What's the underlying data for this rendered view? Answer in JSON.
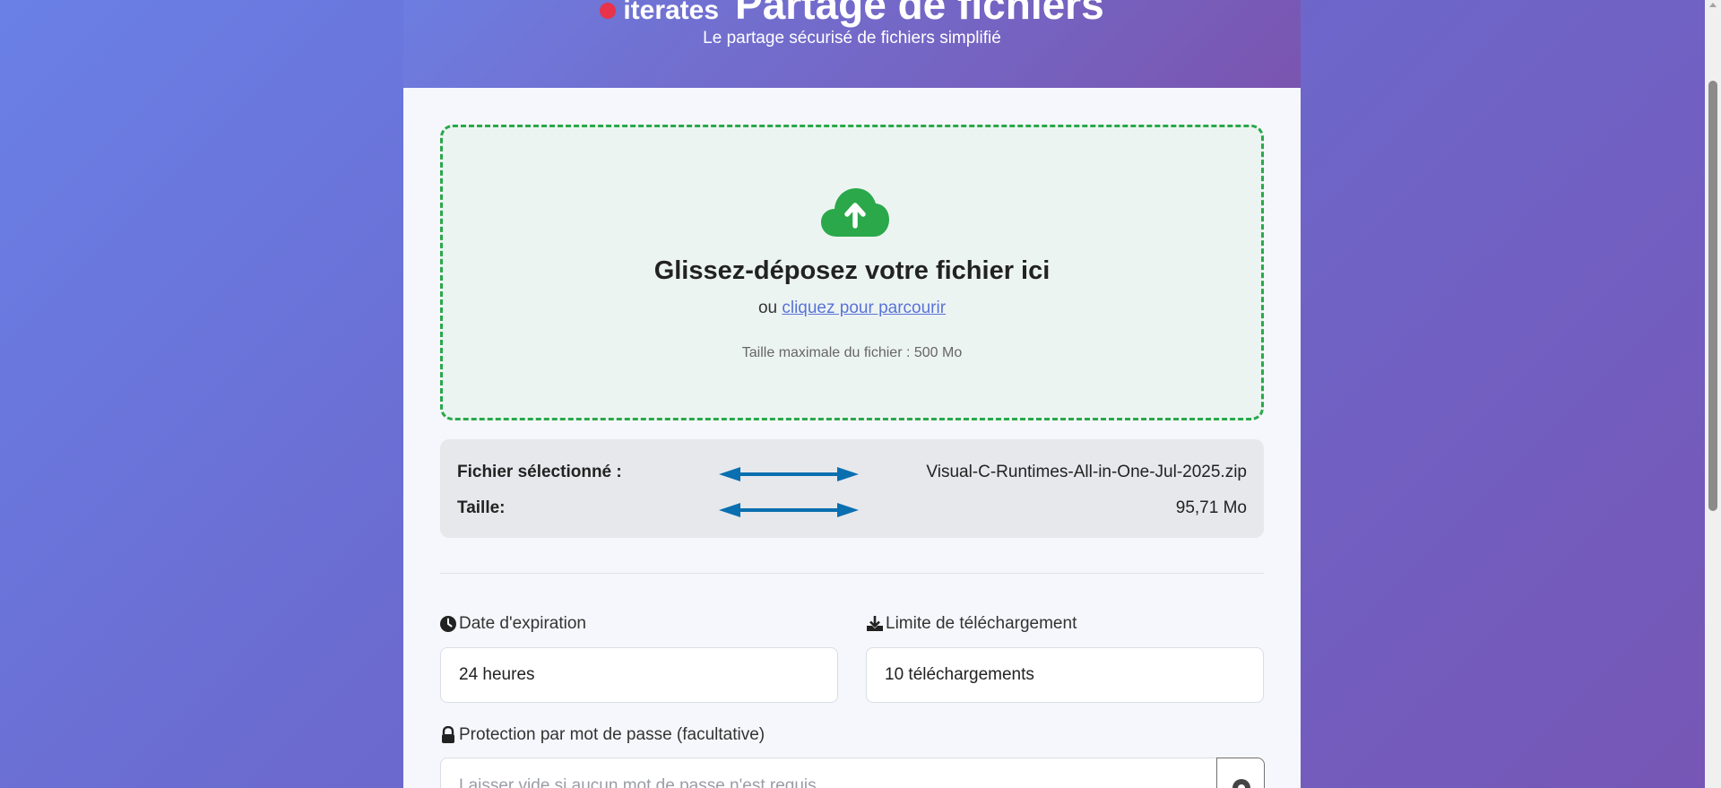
{
  "header": {
    "brand": "iterates",
    "title": "Partage de fichiers",
    "subtitle": "Le partage sécurisé de fichiers simplifié"
  },
  "dropzone": {
    "icon": "cloud-upload-icon",
    "title": "Glissez-déposez votre fichier ici",
    "or_text": "ou",
    "browse_link": "cliquez pour parcourir",
    "max_size": "Taille maximale du fichier : 500 Mo"
  },
  "file_info": {
    "selected_label": "Fichier sélectionné :",
    "selected_value": "Visual-C-Runtimes-All-in-One-Jul-2025.zip",
    "size_label": "Taille:",
    "size_value": "95,71 Mo"
  },
  "options": {
    "expiration_label": "Date d'expiration",
    "expiration_value": "24 heures",
    "download_limit_label": "Limite de téléchargement",
    "download_limit_value": "10 téléchargements",
    "password_label": "Protection par mot de passe (facultative)",
    "password_placeholder": "Laisser vide si aucun mot de passe n'est requis"
  },
  "colors": {
    "accent_green": "#2aa84a",
    "link_blue": "#5a73d8",
    "arrow_blue": "#0a6fb0"
  }
}
